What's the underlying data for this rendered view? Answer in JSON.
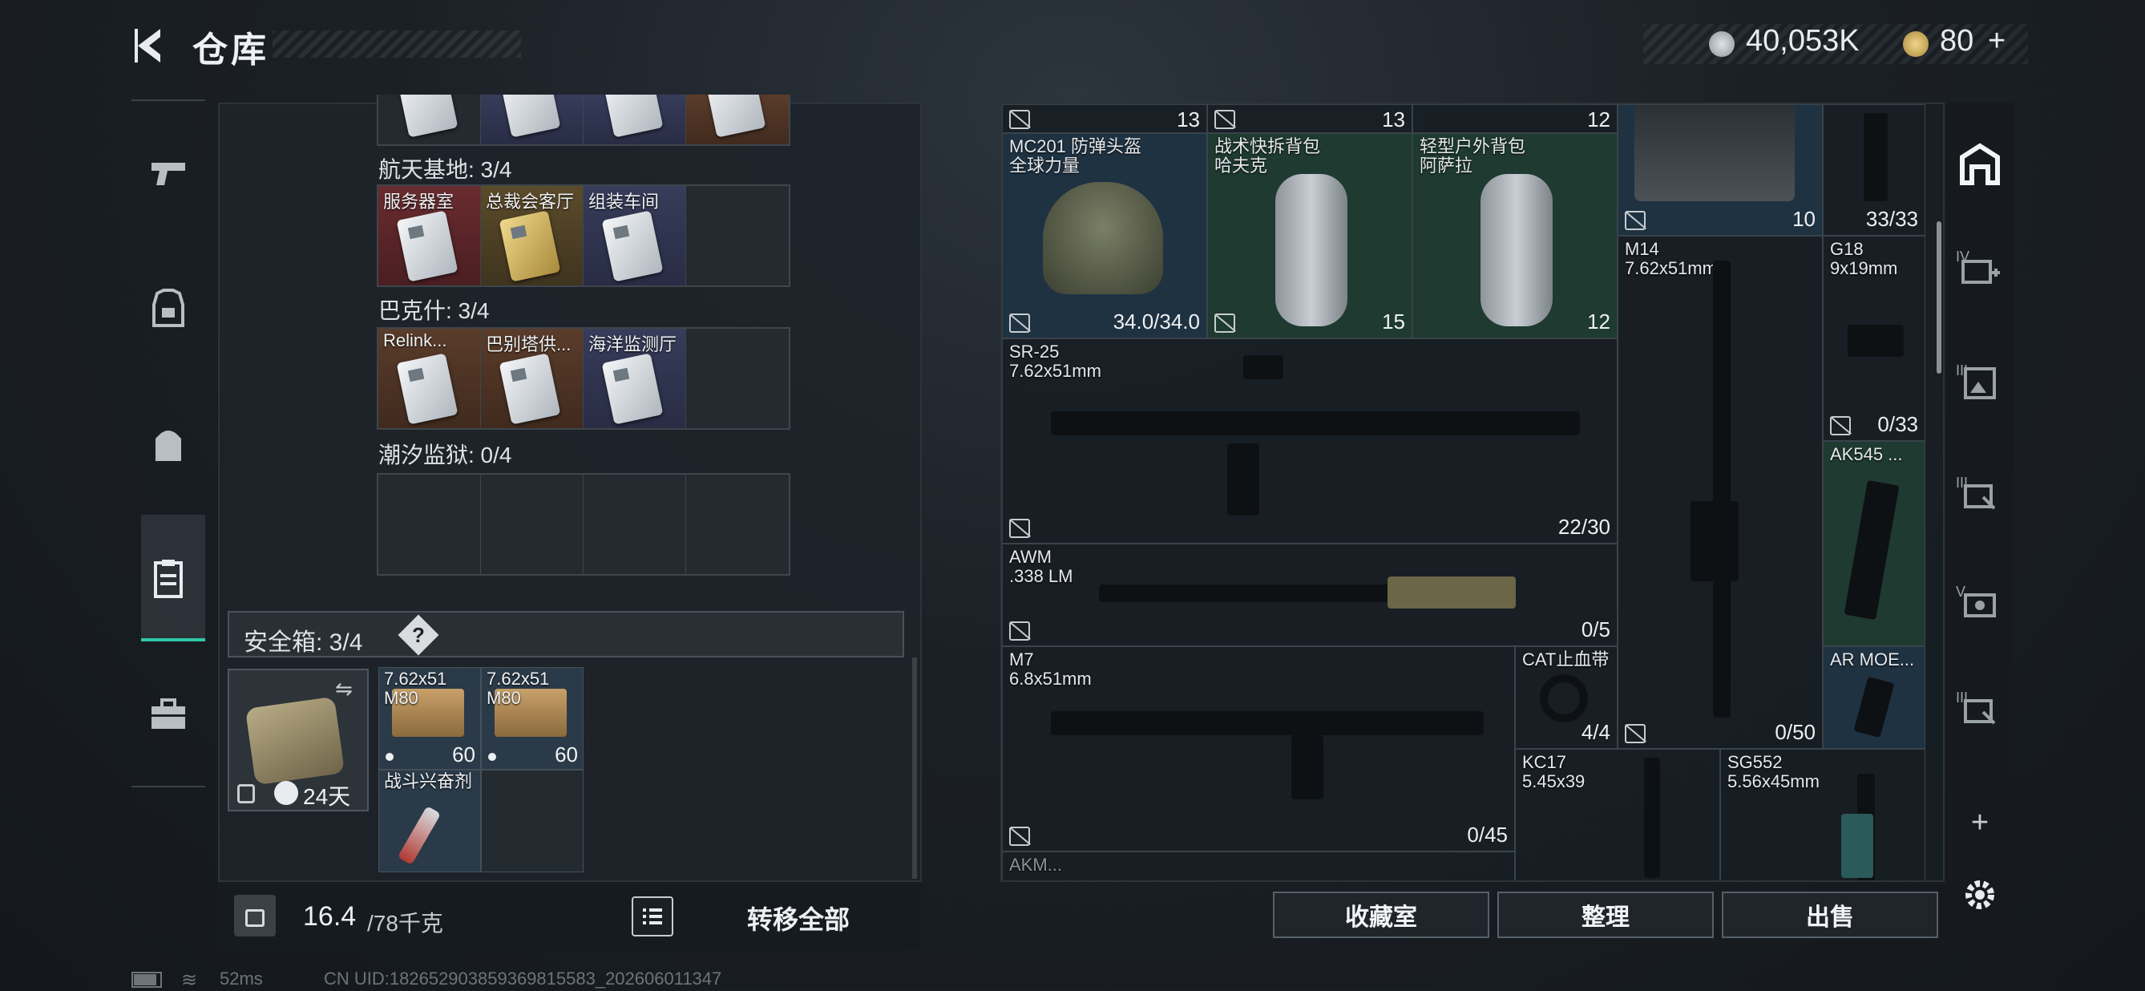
{
  "header": {
    "title": "仓库"
  },
  "currency": {
    "coins": "40,053K",
    "tokens": "80",
    "plus": "+"
  },
  "storage": {
    "sections": [
      {
        "label": "航天基地: 3/4",
        "cards": [
          {
            "name": "服务器室",
            "color": "red"
          },
          {
            "name": "总裁会客厅",
            "color": "gold"
          },
          {
            "name": "组装车间",
            "color": "blue"
          },
          {
            "name": "",
            "color": "dark"
          }
        ]
      },
      {
        "label": "巴克什: 3/4",
        "cards": [
          {
            "name": "Relink...",
            "color": "orange"
          },
          {
            "name": "巴别塔供...",
            "color": "orange"
          },
          {
            "name": "海洋监测厅",
            "color": "blue"
          },
          {
            "name": "",
            "color": "dark"
          }
        ]
      },
      {
        "label": "潮汐监狱: 0/4",
        "cards": []
      }
    ],
    "safebox": {
      "label": "安全箱: 3/4",
      "help": "?",
      "timer": "24天"
    },
    "safe_items": [
      {
        "label": "7.62x51\nM80",
        "count": "60"
      },
      {
        "label": "7.62x51\nM80",
        "count": "60"
      },
      {
        "label": "战斗兴奋剂",
        "count": ""
      }
    ],
    "weight": "16.4",
    "weight_max": "/78千克",
    "transfer_all": "转移全部"
  },
  "inventory": {
    "top_counts": [
      "13",
      "13",
      "12"
    ],
    "items": {
      "helmet": {
        "label": "MC201 防弹头盔\n全球力量",
        "count": "34.0/34.0"
      },
      "bag1": {
        "label": "战术快拆背包\n哈夫克",
        "count": "15"
      },
      "bag2": {
        "label": "轻型户外背包\n阿萨拉",
        "count": "12"
      },
      "vest": {
        "count": "10"
      },
      "g18_top": {
        "count": "33/33"
      },
      "m14": {
        "label": "M14\n7.62x51mm",
        "count": "0/50"
      },
      "g18": {
        "label": "G18\n9x19mm",
        "count": "0/33"
      },
      "sr25": {
        "label": "SR-25\n7.62x51mm",
        "count": "22/30"
      },
      "ak545": {
        "label": "AK545 ..."
      },
      "awm": {
        "label": "AWM\n.338 LM",
        "count": "0/5"
      },
      "m7": {
        "label": "M7\n6.8x51mm",
        "count": "0/45"
      },
      "cat": {
        "label": "CAT止血带",
        "count": "4/4"
      },
      "armoe": {
        "label": "AR MOE..."
      },
      "kc17": {
        "label": "KC17\n5.45x39"
      },
      "sg552": {
        "label": "SG552\n5.56x45mm"
      },
      "akm": {
        "label": "AKM..."
      }
    },
    "buttons": {
      "collection": "收藏室",
      "sort": "整理",
      "sell": "出售"
    }
  },
  "right_rail": {
    "labels": [
      "IV",
      "III",
      "III",
      "V",
      "III"
    ],
    "add": "+"
  },
  "status": {
    "ping": "52ms",
    "uid": "CN UID:182652903859369815583_202606011347"
  },
  "colors": {
    "accent": "#2fc6a6"
  }
}
